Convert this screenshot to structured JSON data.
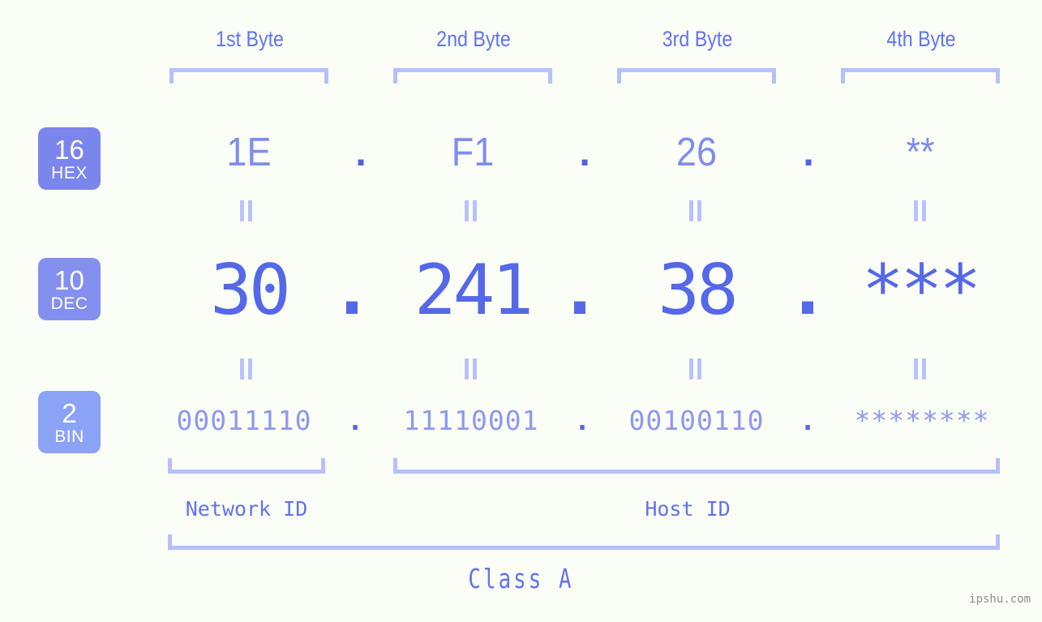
{
  "meta": {
    "site": "ipshu.com",
    "background_color": "#fbfdf7",
    "accent_color": "#5468e9",
    "light_accent_color": "#b6c0fb",
    "badge_colors": [
      "#7b86ec",
      "#8490ef",
      "#8ba3f6"
    ]
  },
  "byte_headers": [
    {
      "label": "1st Byte"
    },
    {
      "label": "2nd Byte"
    },
    {
      "label": "3rd Byte"
    },
    {
      "label": "4th Byte"
    }
  ],
  "rows": [
    {
      "badge_number": "16",
      "badge_base": "HEX",
      "values": [
        "1E",
        "F1",
        "26",
        "**"
      ],
      "separator": "."
    },
    {
      "badge_number": "10",
      "badge_base": "DEC",
      "values": [
        "30",
        "241",
        "38",
        "***"
      ],
      "separator": "."
    },
    {
      "badge_number": "2",
      "badge_base": "BIN",
      "values": [
        "00011110",
        "11110001",
        "00100110",
        "********"
      ],
      "separator": "."
    }
  ],
  "equivalence_symbol": "=",
  "id_sections": [
    {
      "label": "Network ID"
    },
    {
      "label": "Host ID"
    }
  ],
  "class_label": "Class A",
  "watermark": "ipshu.com"
}
